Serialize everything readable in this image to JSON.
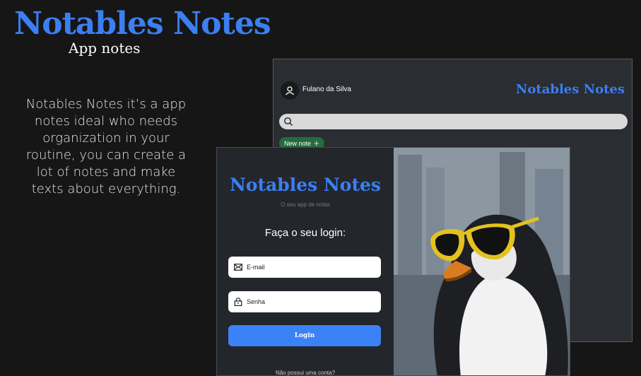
{
  "hero": {
    "title": "Notables Notes",
    "subtitle": "App notes",
    "description": "Notables Notes it’s a app notes ideal who needs organization in your routine, you can create a lot of notes and make texts about everything."
  },
  "app_window": {
    "user_name": "Fulano da Silva",
    "brand": "Notables Notes",
    "search_placeholder": "",
    "new_note_label": "New note",
    "new_note_icon": "plus-icon"
  },
  "login": {
    "brand": "Notables Notes",
    "tagline": "O seu app de notas",
    "heading": "Faça o seu login:",
    "email_placeholder": "E-mail",
    "password_placeholder": "Senha",
    "button_label": "Login",
    "signup_text": "Não possui uma conta?",
    "photo_subject": "penguin wearing yellow sunglasses"
  },
  "colors": {
    "accent": "#3b7ff2",
    "background": "#161616",
    "panel": "#23262b",
    "new_note_green": "#256b3e",
    "button_blue": "#3b82f6"
  }
}
